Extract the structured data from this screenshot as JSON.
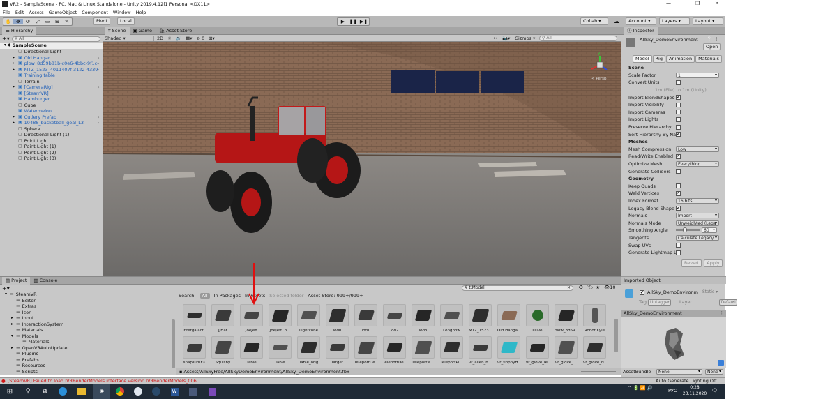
{
  "window": {
    "title": "VR2 - SampleScene - PC, Mac & Linux Standalone - Unity 2019.4.12f1 Personal <DX11>",
    "min": "—",
    "max": "❐",
    "close": "✕"
  },
  "menu": [
    "File",
    "Edit",
    "Assets",
    "GameObject",
    "Component",
    "Window",
    "Help"
  ],
  "toolbar": {
    "pivot": "Pivot",
    "local": "Local",
    "collab": "Collab ▾",
    "account": "Account ▾",
    "layers": "Layers ▾",
    "layout": "Layout ▾"
  },
  "hierarchy": {
    "title": "Hierarchy",
    "search": "All",
    "scene": "SampleScene",
    "items": [
      {
        "label": "Directional Light",
        "prefab": false,
        "expand": false
      },
      {
        "label": "Old Hangar",
        "prefab": true,
        "expand": true
      },
      {
        "label": "plow_8d59b81b-c0e6-4bbc-9f1c-",
        "prefab": true,
        "expand": true
      },
      {
        "label": "MTZ_1523_4011407f-3122-4339",
        "prefab": true,
        "expand": true
      },
      {
        "label": "Training table",
        "prefab": true,
        "expand": false
      },
      {
        "label": "Terrain",
        "prefab": false,
        "expand": false
      },
      {
        "label": "[CameraRig]",
        "prefab": true,
        "expand": true
      },
      {
        "label": "[SteamVR]",
        "prefab": true,
        "expand": false
      },
      {
        "label": "Hamburger",
        "prefab": true,
        "expand": false
      },
      {
        "label": "Cube",
        "prefab": false,
        "expand": false
      },
      {
        "label": "Watermelon",
        "prefab": true,
        "expand": false
      },
      {
        "label": "Cutlery Prefab",
        "prefab": true,
        "expand": true
      },
      {
        "label": "10488_basketball_goal_L3",
        "prefab": true,
        "expand": true
      },
      {
        "label": "Sphere",
        "prefab": false,
        "expand": false
      },
      {
        "label": "Directional Light (1)",
        "prefab": false,
        "expand": false
      },
      {
        "label": "Point Light",
        "prefab": false,
        "expand": false
      },
      {
        "label": "Point Light (1)",
        "prefab": false,
        "expand": false
      },
      {
        "label": "Point Light (2)",
        "prefab": false,
        "expand": false
      },
      {
        "label": "Point Light (3)",
        "prefab": false,
        "expand": false
      }
    ]
  },
  "scene": {
    "tabs": [
      "Scene",
      "Game",
      "Asset Store"
    ],
    "shading": "Shaded",
    "mode2d": "2D",
    "gizmos": "Gizmos ▾",
    "search": "All",
    "persp": "< Persp"
  },
  "inspector": {
    "title": "Inspector",
    "asset_name": "AllSky_DemoEnvironment",
    "open": "Open",
    "tabs": [
      "Model",
      "Rig",
      "Animation",
      "Materials"
    ],
    "sections": [
      {
        "header": "Scene",
        "rows": [
          {
            "label": "Scale Factor",
            "type": "text",
            "value": "1"
          },
          {
            "label": "Convert Units",
            "type": "check",
            "value": ""
          },
          {
            "label": "",
            "type": "note",
            "value": "1m (File) to 1m (Unity)"
          },
          {
            "label": "Import BlendShapes",
            "type": "check",
            "value": "✔"
          },
          {
            "label": "Import Visibility",
            "type": "check",
            "value": ""
          },
          {
            "label": "Import Cameras",
            "type": "check",
            "value": ""
          },
          {
            "label": "Import Lights",
            "type": "check",
            "value": ""
          },
          {
            "label": "Preserve Hierarchy",
            "type": "check",
            "value": ""
          },
          {
            "label": "Sort Hierarchy By Na",
            "type": "check",
            "value": "✔"
          }
        ]
      },
      {
        "header": "Meshes",
        "rows": [
          {
            "label": "Mesh Compression",
            "type": "dd",
            "value": "Low"
          },
          {
            "label": "Read/Write Enabled",
            "type": "check",
            "value": "✔"
          },
          {
            "label": "Optimize Mesh",
            "type": "dd",
            "value": "Everything"
          },
          {
            "label": "Generate Colliders",
            "type": "check",
            "value": ""
          }
        ]
      },
      {
        "header": "Geometry",
        "rows": [
          {
            "label": "Keep Quads",
            "type": "check",
            "value": ""
          },
          {
            "label": "Weld Vertices",
            "type": "check",
            "value": "✔"
          },
          {
            "label": "Index Format",
            "type": "dd",
            "value": "16 bits"
          },
          {
            "label": "Legacy Blend Shape",
            "type": "check",
            "value": "✔"
          },
          {
            "label": "Normals",
            "type": "dd",
            "value": "Import"
          },
          {
            "label": "Normals Mode",
            "type": "dd",
            "value": "Unweighted (Lega"
          },
          {
            "label": "Smoothing Angle",
            "type": "slider",
            "value": "60"
          },
          {
            "label": "Tangents",
            "type": "dd",
            "value": "Calculate Legacy"
          },
          {
            "label": "Swap UVs",
            "type": "check",
            "value": ""
          },
          {
            "label": "Generate Lightmap U",
            "type": "check",
            "value": ""
          }
        ]
      }
    ],
    "revert": "Revert",
    "apply": "Apply",
    "imported": "Imported Object",
    "obj_name": "AllSky_DemoEnvironm",
    "static": "Static ▾",
    "tag_label": "Tag",
    "tag": "Untagged",
    "layer_label": "Layer",
    "layer": "Default",
    "preview_title": "AllSky_DemoEnvironment",
    "assetbundle": "AssetBundle",
    "ab1": "None",
    "ab2": "None"
  },
  "project": {
    "tabs": [
      "Project",
      "Console"
    ],
    "filter": "t:Model",
    "count": "10",
    "tree": [
      {
        "label": "SteamVR",
        "d": 0,
        "exp": true
      },
      {
        "label": "Editor",
        "d": 1
      },
      {
        "label": "Extras",
        "d": 1
      },
      {
        "label": "Icon",
        "d": 1
      },
      {
        "label": "Input",
        "d": 1,
        "exp": false
      },
      {
        "label": "InteractionSystem",
        "d": 1,
        "exp": false
      },
      {
        "label": "Materials",
        "d": 1
      },
      {
        "label": "Models",
        "d": 1,
        "exp": true
      },
      {
        "label": "Materials",
        "d": 2
      },
      {
        "label": "OpenVRAutoUpdater",
        "d": 1,
        "exp": false
      },
      {
        "label": "Plugins",
        "d": 1
      },
      {
        "label": "Prefabs",
        "d": 1
      },
      {
        "label": "Resources",
        "d": 1
      },
      {
        "label": "Scripts",
        "d": 1
      }
    ],
    "search_tabs": {
      "search": "Search:",
      "all": "All",
      "packages": "In Packages",
      "assets": "In Assets",
      "selected": "Selected folder",
      "store": "Asset Store: 999+/999+"
    },
    "row1": [
      "Intergalact...",
      "JJHat",
      "JoeJeff",
      "JoeJeffCo...",
      "Lightcone",
      "lod0",
      "lod1",
      "lod2",
      "lod3",
      "Longbow",
      "MTZ_1523...",
      "Old Hanga...",
      "Olive",
      "plow_8d59...",
      "Robot Kyle"
    ],
    "row2": [
      "snapTurnFX",
      "Squishy",
      "Table",
      "Table",
      "Table_orig",
      "Target",
      "TeleportDe...",
      "TeleportDe...",
      "TeleportM...",
      "TeleportPl...",
      "vr_alien_h...",
      "vr_floppyH...",
      "vr_glove_le...",
      "vr_glove_...",
      "vr_glove_ri..."
    ],
    "path": "Assets/AllSkyFree/AllSkyDemoEnvironment/AllSky_DemoEnvironment.fbx"
  },
  "status": {
    "error": "[SteamVR] Failed to load IVRRenderModels interface version IVRRenderModels_006",
    "lighting": "Auto Generate Lighting Off"
  },
  "taskbar": {
    "lang": "РУС",
    "time": "0:28",
    "date": "23.11.2020"
  }
}
